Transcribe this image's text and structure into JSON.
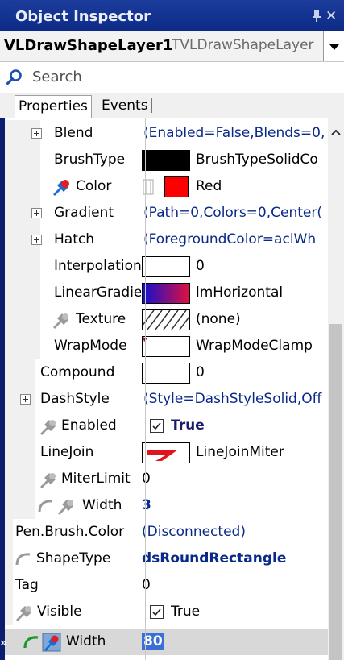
{
  "window": {
    "title": "Object Inspector"
  },
  "object": {
    "name": "VLDrawShapeLayer1",
    "type": "TVLDrawShapeLayer"
  },
  "search": {
    "placeholder": "Search"
  },
  "tabs": [
    {
      "label": "Properties"
    },
    {
      "label": "Events"
    }
  ],
  "properties": [
    {
      "name": "Blend",
      "value": "(Enabled=False,Blends=0,",
      "expandable": true
    },
    {
      "name": "BrushType",
      "value": "BrushTypeSolidCo"
    },
    {
      "name": "Color",
      "value": "Red"
    },
    {
      "name": "Gradient",
      "value": "(Path=0,Colors=0,Center(",
      "expandable": true
    },
    {
      "name": "Hatch",
      "value": "(ForegroundColor=aclWh",
      "expandable": true
    },
    {
      "name": "Interpolation",
      "value": "0"
    },
    {
      "name": "LinearGradient",
      "value": "lmHorizontal"
    },
    {
      "name": "Texture",
      "value": "(none)"
    },
    {
      "name": "WrapMode",
      "value": "WrapModeClamp"
    },
    {
      "name": "Compound",
      "value": "0"
    },
    {
      "name": "DashStyle",
      "value": "(Style=DashStyleSolid,Off",
      "expandable": true
    },
    {
      "name": "Enabled",
      "value": "True",
      "checked": true
    },
    {
      "name": "LineJoin",
      "value": "LineJoinMiter"
    },
    {
      "name": "MiterLimit",
      "value": "0"
    },
    {
      "name": "Width",
      "value": "3"
    },
    {
      "name": "Pen.Brush.Color",
      "value": "(Disconnected)"
    },
    {
      "name": "ShapeType",
      "value": "dsRoundRectangle"
    },
    {
      "name": "Tag",
      "value": "0"
    },
    {
      "name": "Visible",
      "value": "True",
      "checked": true
    },
    {
      "name": "Width",
      "value": "80",
      "selected": true
    }
  ],
  "colors": {
    "titlebar": "#0d2a86",
    "brush_swatch": "#000000",
    "color_swatch": "#ff0000",
    "value_text": "#0a2a8a",
    "selection": "#3a6fd8"
  }
}
